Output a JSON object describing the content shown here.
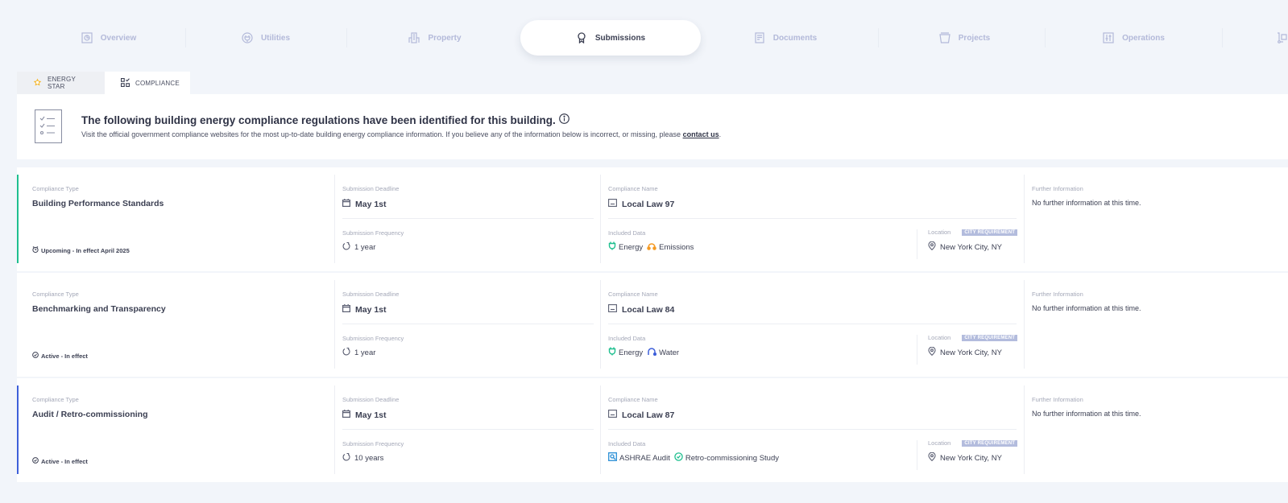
{
  "nav": {
    "items": [
      {
        "label": "Overview",
        "icon": "overview-icon",
        "active": false
      },
      {
        "label": "Utilities",
        "icon": "plug-icon",
        "active": false
      },
      {
        "label": "Property",
        "icon": "building-icon",
        "active": false
      },
      {
        "label": "Submissions",
        "icon": "award-ribbon-icon",
        "active": true
      },
      {
        "label": "Documents",
        "icon": "document-icon",
        "active": false
      },
      {
        "label": "Projects",
        "icon": "bucket-icon",
        "active": false
      },
      {
        "label": "Operations",
        "icon": "sliders-icon",
        "active": false
      }
    ]
  },
  "subtabs": {
    "energy_star": "ENERGY STAR",
    "compliance": "COMPLIANCE"
  },
  "intro": {
    "title": "The following building energy compliance regulations have been identified for this building.",
    "text": "Visit the official government compliance websites for the most up-to-date building energy compliance information. If you believe any of the information below is incorrect, or missing, please ",
    "link": "contact us",
    "end": "."
  },
  "labels": {
    "compliance_type": "Compliance Type",
    "submission_deadline": "Submission Deadline",
    "submission_frequency": "Submission Frequency",
    "compliance_name": "Compliance Name",
    "included_data": "Included Data",
    "location": "Location",
    "further_information": "Further Information"
  },
  "colors": {
    "upcoming_accent": "#1fbf8f",
    "audit_accent": "#3d5fd9",
    "energy": "#1fbf8f",
    "emissions": "#f59a23",
    "water": "#3d5fd9",
    "audit": "#2b8fd6",
    "rcx": "#1fbf8f"
  },
  "rows": [
    {
      "type": "Building Performance Standards",
      "status": "Upcoming - In effect April 2025",
      "status_kind": "upcoming",
      "deadline": "May 1st",
      "frequency": "1 year",
      "name": "Local Law 97",
      "included": [
        {
          "label": "Energy",
          "icon": "energy-icon"
        },
        {
          "label": "Emissions",
          "icon": "emissions-icon"
        }
      ],
      "badge": "CITY REQUIREMENT",
      "location": "New York City, NY",
      "further": "No further information at this time."
    },
    {
      "type": "Benchmarking and Transparency",
      "status": "Active - In effect",
      "status_kind": "active",
      "deadline": "May 1st",
      "frequency": "1 year",
      "name": "Local Law 84",
      "included": [
        {
          "label": "Energy",
          "icon": "energy-icon"
        },
        {
          "label": "Water",
          "icon": "water-icon"
        }
      ],
      "badge": "CITY REQUIREMENT",
      "location": "New York City, NY",
      "further": "No further information at this time."
    },
    {
      "type": "Audit / Retro-commissioning",
      "status": "Active - In effect",
      "status_kind": "active",
      "deadline": "May 1st",
      "frequency": "10 years",
      "name": "Local Law 87",
      "included": [
        {
          "label": "ASHRAE Audit",
          "icon": "audit-icon"
        },
        {
          "label": "Retro-commissioning Study",
          "icon": "retro-commissioning-icon"
        }
      ],
      "badge": "CITY REQUIREMENT",
      "location": "New York City, NY",
      "further": "No further information at this time."
    }
  ]
}
